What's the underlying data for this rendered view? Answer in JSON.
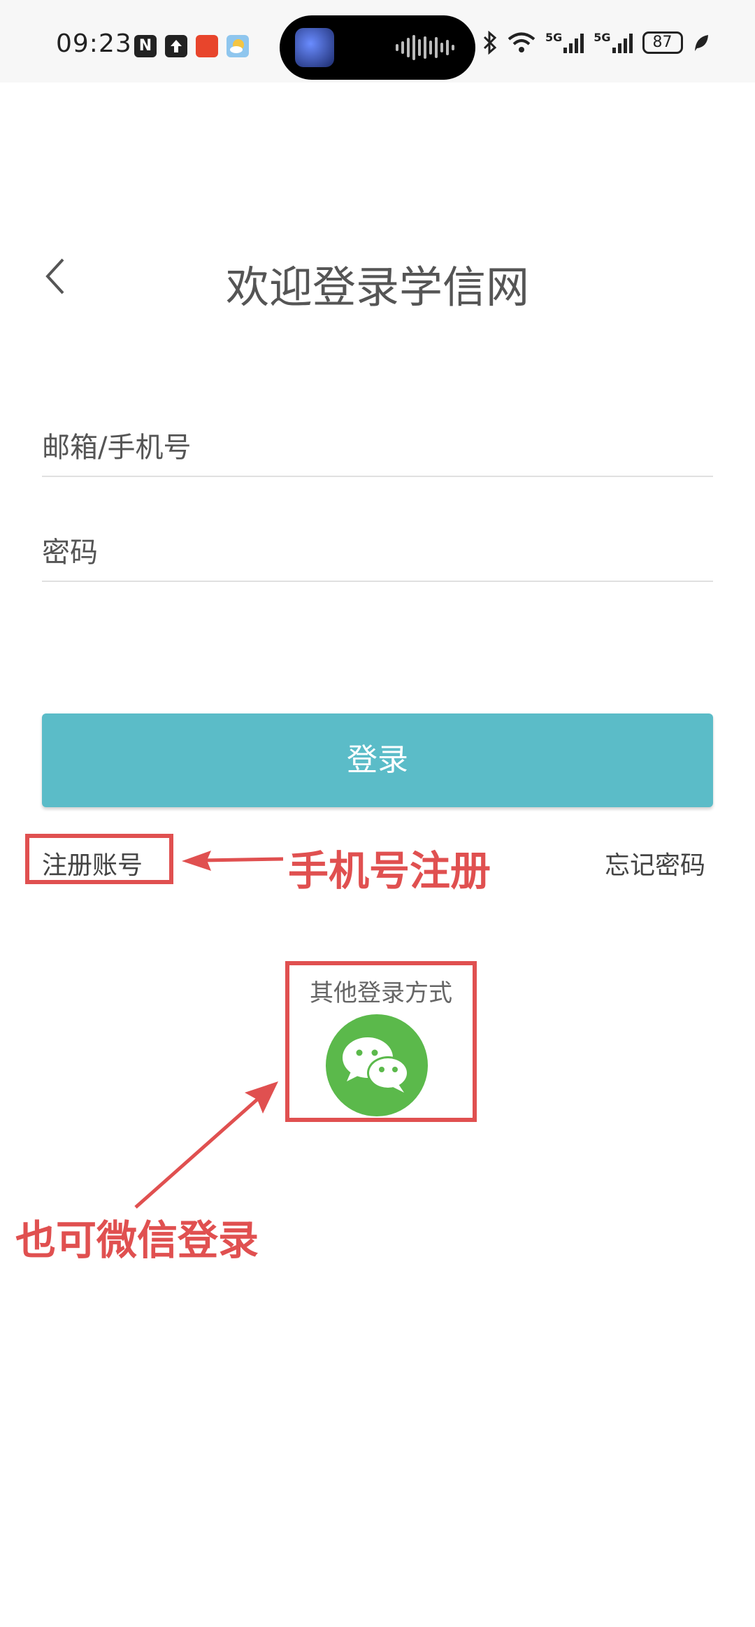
{
  "status_bar": {
    "time": "09:23",
    "battery": "87",
    "network_label_1": "5G",
    "network_label_2": "5G"
  },
  "header": {
    "back_icon": "chevron-left-icon",
    "title": "欢迎登录学信网"
  },
  "form": {
    "account_placeholder": "邮箱/手机号",
    "password_placeholder": "密码",
    "login_label": "登录"
  },
  "links": {
    "register": "注册账号",
    "forgot_password": "忘记密码"
  },
  "other_login": {
    "label": "其他登录方式",
    "icon": "wechat-icon"
  },
  "annotations": {
    "register_note": "手机号注册",
    "wechat_note": "也可微信登录",
    "color": "#e05050"
  },
  "colors": {
    "login_button": "#5bbcc8",
    "wechat": "#5bb94b"
  }
}
